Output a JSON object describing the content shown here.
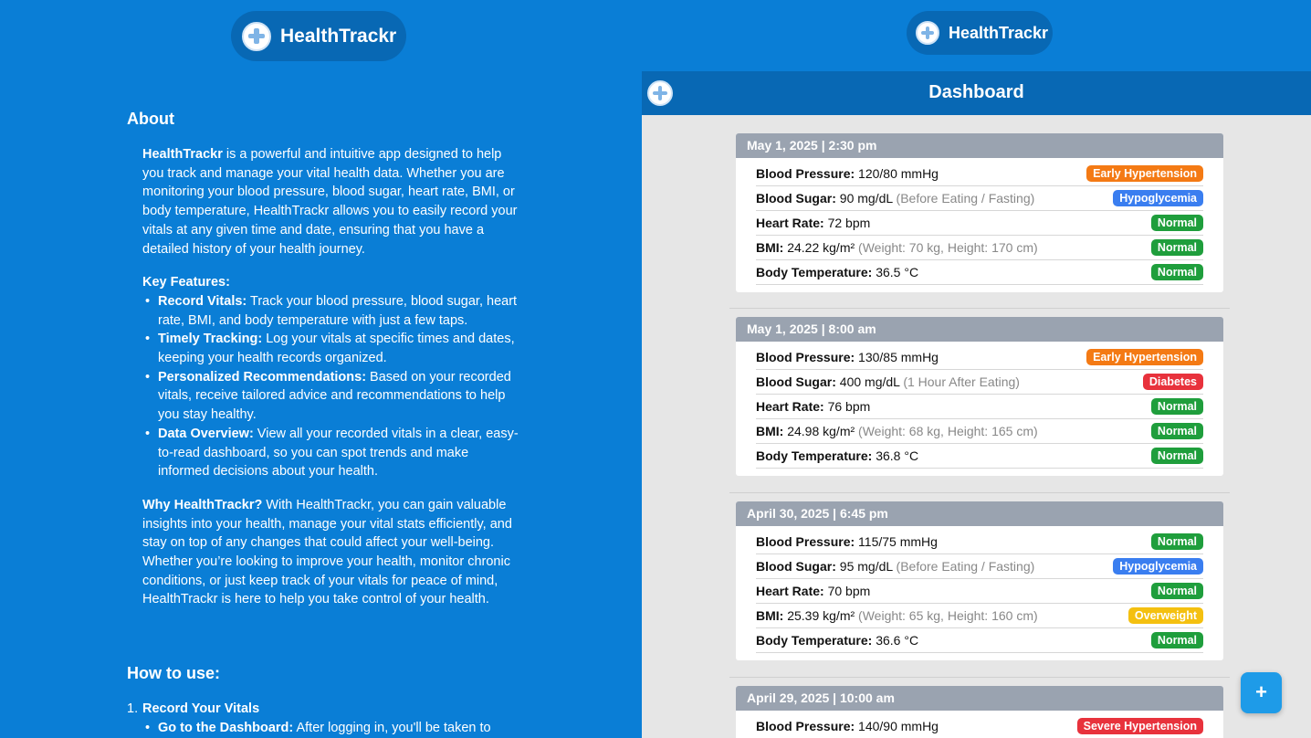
{
  "app": {
    "name": "HealthTrackr"
  },
  "about": {
    "heading": "About",
    "intro_bold": "HealthTrackr",
    "intro": " is a powerful and intuitive app designed to help you track and manage your vital health data. Whether you are monitoring your blood pressure, blood sugar, heart rate, BMI, or body temperature, HealthTrackr allows you to easily record your vitals at any given time and date, ensuring that you have a detailed history of your health journey.",
    "features_heading": "Key Features:",
    "features": [
      {
        "title": "Record Vitals:",
        "text": " Track your blood pressure, blood sugar, heart rate, BMI, and body temperature with just a few taps."
      },
      {
        "title": "Timely Tracking:",
        "text": " Log your vitals at specific times and dates, keeping your health records organized."
      },
      {
        "title": "Personalized Recommendations:",
        "text": " Based on your recorded vitals, receive tailored advice and recommendations to help you stay healthy."
      },
      {
        "title": "Data Overview:",
        "text": " View all your recorded vitals in a clear, easy-to-read dashboard, so you can spot trends and make informed decisions about your health."
      }
    ],
    "why_bold": "Why HealthTrackr?",
    "why": " With HealthTrackr, you can gain valuable insights into your health, manage your vital stats efficiently, and stay on top of any changes that could affect your well-being. Whether you’re looking to improve your health, monitor chronic conditions, or just keep track of your vitals for peace of mind, HealthTrackr is here to help you take control of your health."
  },
  "howto": {
    "heading": "How to use:",
    "step1_num": "1.",
    "step1": "Record Your Vitals",
    "step1_sub_bold": "Go to the Dashboard:",
    "step1_sub": " After logging in, you'll be taken to"
  },
  "dashboard": {
    "title": "Dashboard",
    "fab": "+",
    "labels": {
      "bp": "Blood Pressure:",
      "bs": "Blood Sugar:",
      "hr": "Heart Rate:",
      "bmi": "BMI:",
      "temp": "Body Temperature:"
    },
    "colors": {
      "orange": "#f47a14",
      "blue": "#3a7ef0",
      "green": "#1f9e3c",
      "red": "#e8323c",
      "yellow": "#f4c010"
    },
    "entries": [
      {
        "date": "May 1, 2025 | 2:30 pm",
        "bp": "120/80 mmHg",
        "bp_badge": "Early Hypertension",
        "bs": "90 mg/dL",
        "bs_note": "(Before Eating / Fasting)",
        "bs_badge": "Hypoglycemia",
        "hr": "72 bpm",
        "hr_badge": "Normal",
        "bmi": "24.22 kg/m²",
        "bmi_note": "(Weight: 70 kg, Height: 170 cm)",
        "bmi_badge": "Normal",
        "temp": "36.5 °C",
        "temp_badge": "Normal"
      },
      {
        "date": "May 1, 2025 | 8:00 am",
        "bp": "130/85 mmHg",
        "bp_badge": "Early Hypertension",
        "bs": "400 mg/dL",
        "bs_note": "(1 Hour After Eating)",
        "bs_badge": "Diabetes",
        "hr": "76 bpm",
        "hr_badge": "Normal",
        "bmi": "24.98 kg/m²",
        "bmi_note": "(Weight: 68 kg, Height: 165 cm)",
        "bmi_badge": "Normal",
        "temp": "36.8 °C",
        "temp_badge": "Normal"
      },
      {
        "date": "April 30, 2025 | 6:45 pm",
        "bp": "115/75 mmHg",
        "bp_badge": "Normal",
        "bs": "95 mg/dL",
        "bs_note": "(Before Eating / Fasting)",
        "bs_badge": "Hypoglycemia",
        "hr": "70 bpm",
        "hr_badge": "Normal",
        "bmi": "25.39 kg/m²",
        "bmi_note": "(Weight: 65 kg, Height: 160 cm)",
        "bmi_badge": "Overweight",
        "temp": "36.6 °C",
        "temp_badge": "Normal"
      },
      {
        "date": "April 29, 2025 | 10:00 am",
        "bp": "140/90 mmHg",
        "bp_badge": "Severe Hypertension"
      }
    ]
  }
}
